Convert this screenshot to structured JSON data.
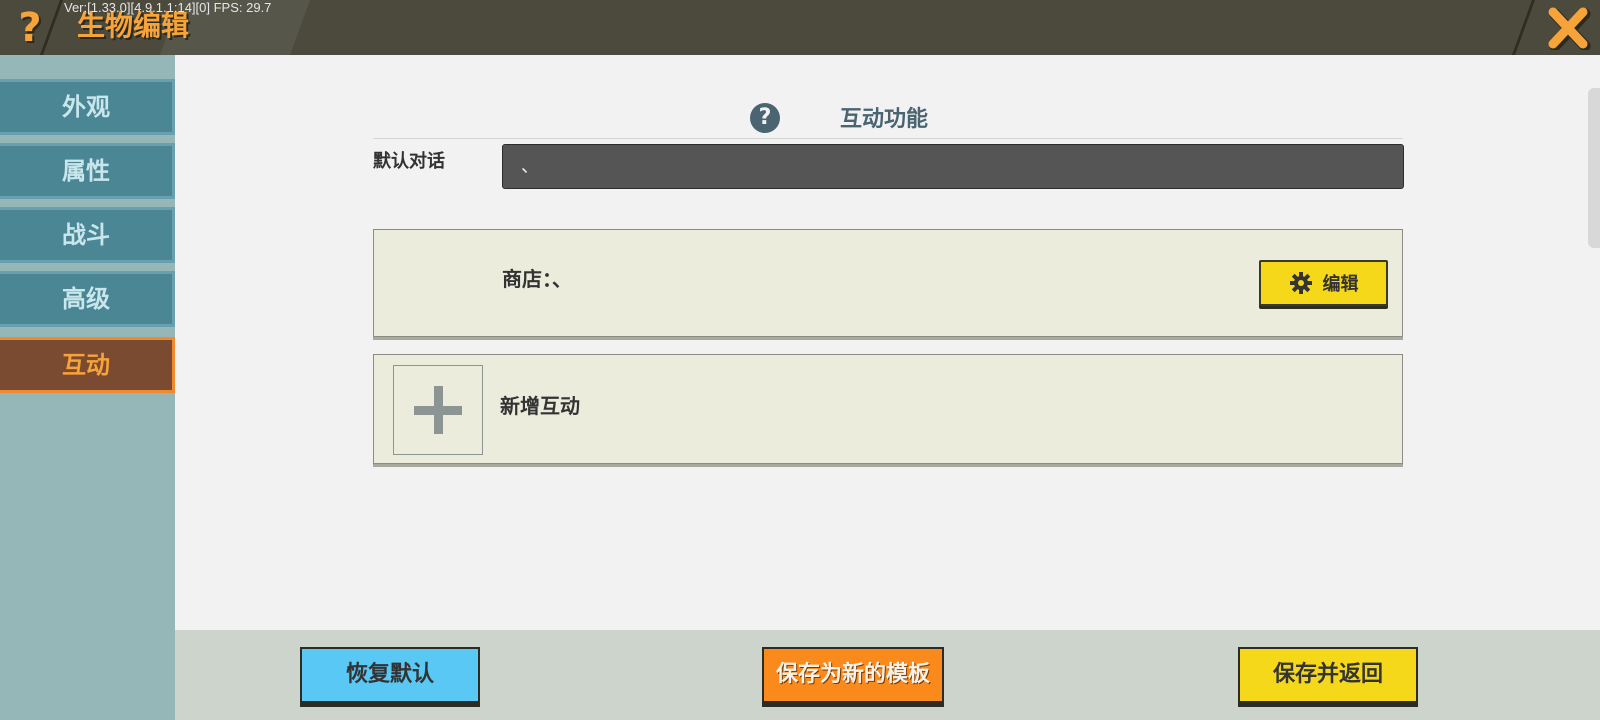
{
  "header": {
    "help_icon_glyph": "?",
    "title": "生物编辑",
    "version_text": "Ver:[1.33.0][4.9.1.1:14][0] FPS: 29.7",
    "close_icon": "close-x-icon"
  },
  "sidebar": {
    "items": [
      {
        "label": "外观",
        "active": false
      },
      {
        "label": "属性",
        "active": false
      },
      {
        "label": "战斗",
        "active": false
      },
      {
        "label": "高级",
        "active": false
      },
      {
        "label": "互动",
        "active": true
      }
    ]
  },
  "main": {
    "section_title": "互动功能",
    "section_help_glyph": "?",
    "default_dialog_label": "默认对话",
    "default_dialog_value": "、",
    "shop_label": "商店：、",
    "edit_button_label": "编辑",
    "add_interaction_label": "新增互动"
  },
  "footer": {
    "restore_label": "恢复默认",
    "save_template_label": "保存为新的模板",
    "save_return_label": "保存并返回"
  },
  "colors": {
    "accent_orange": "#f6a33a",
    "yellow_button": "#f5d81a",
    "blue_button": "#5ac8f5",
    "orange_button": "#fa8a1c",
    "sidebar_tab": "#4b8694"
  }
}
